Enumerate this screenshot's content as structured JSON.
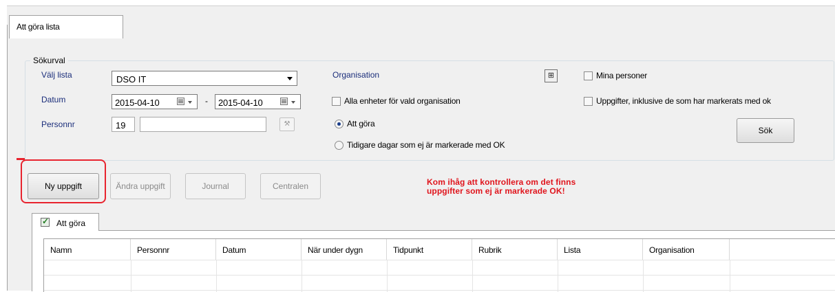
{
  "window": {
    "tab_label": "Att göra lista"
  },
  "search": {
    "group_title": "Sökurval",
    "list_label": "Välj lista",
    "list_value": "DSO IT",
    "date_label": "Datum",
    "date_from": "2015-04-10",
    "date_separator": "-",
    "date_to": "2015-04-10",
    "personnr_label": "Personnr",
    "personnr_prefix": "19",
    "personnr_value": "",
    "organisation_label": "Organisation",
    "all_units_label": "Alla enheter för vald organisation",
    "radio_todo_label": "Att göra",
    "radio_earlier_label": "Tidigare dagar som ej är markerade med OK",
    "my_persons_label": "Mina personer",
    "include_ok_label": "Uppgifter, inklusive de som har markerats med ok",
    "search_button": "Sök",
    "org_icon": "org-chart-icon"
  },
  "actions": {
    "new_task": "Ny uppgift",
    "edit_task": "Ändra uppgift",
    "journal": "Journal",
    "central": "Centralen"
  },
  "warning": {
    "line1": "Kom ihåg att kontrollera om det finns",
    "line2": "uppgifter som ej är markerade OK!",
    "color": "#e0141c"
  },
  "results_tab": {
    "label": "Att göra",
    "checked": true
  },
  "table": {
    "columns": [
      "Namn",
      "Personnr",
      "Datum",
      "När under dygn",
      "Tidpunkt",
      "Rubrik",
      "Lista",
      "Organisation"
    ],
    "rows": []
  },
  "colors": {
    "label_blue": "#1a2d7a",
    "annotation_red": "#e8232e"
  }
}
